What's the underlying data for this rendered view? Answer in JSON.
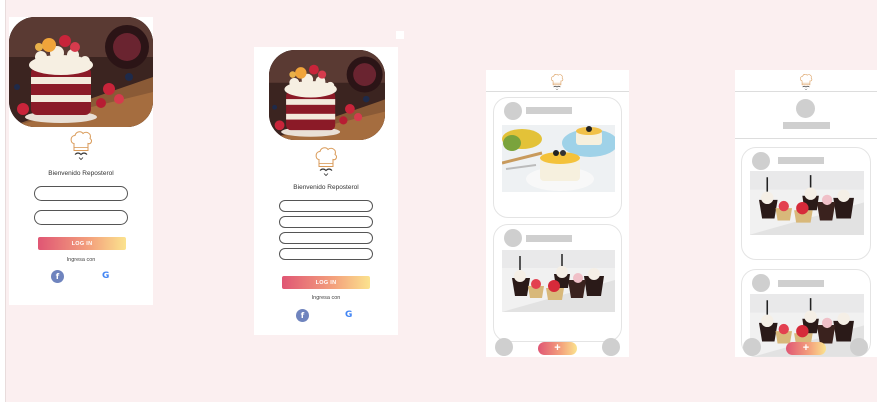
{
  "login": {
    "welcome": "Bienvenido Reposterol",
    "button": "LOG IN",
    "ingresa": "Ingresa con",
    "facebook_glyph": "f",
    "google_glyph": "G"
  },
  "feed": {
    "plus": "+"
  },
  "colors": {
    "background": "#fbeff0",
    "gradient_start": "#e05674",
    "gradient_end": "#fbe38e",
    "placeholder_gray": "#cfcfcf"
  },
  "icons": [
    "chef-hat-icon",
    "facebook-icon",
    "google-icon",
    "plus-icon"
  ]
}
